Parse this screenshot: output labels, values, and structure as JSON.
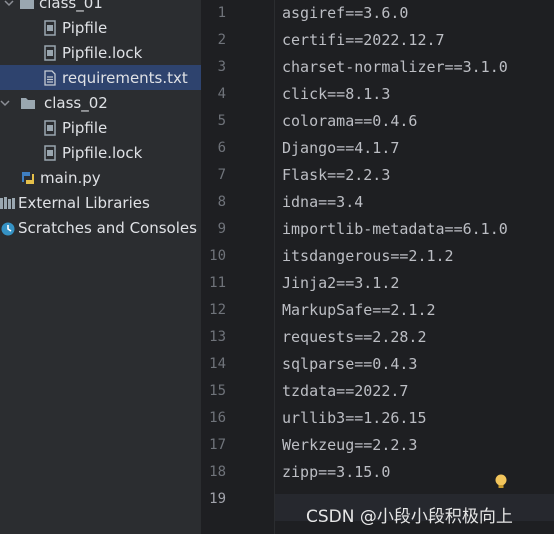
{
  "tree": {
    "class_01": "class_01",
    "pipfile_1": "Pipfile",
    "pipfile_lock_1": "Pipfile.lock",
    "requirements": "requirements.txt",
    "class_02": "class_02",
    "pipfile_2": "Pipfile",
    "pipfile_lock_2": "Pipfile.lock",
    "main": "main.py",
    "external_libraries": "External Libraries",
    "scratches": "Scratches and Consoles"
  },
  "editor": {
    "line_numbers": [
      "1",
      "2",
      "3",
      "4",
      "5",
      "6",
      "7",
      "8",
      "9",
      "10",
      "11",
      "12",
      "13",
      "14",
      "15",
      "16",
      "17",
      "18",
      "19"
    ],
    "lines": [
      "asgiref==3.6.0",
      "certifi==2022.12.7",
      "charset-normalizer==3.1.0",
      "click==8.1.3",
      "colorama==0.4.6",
      "Django==4.1.7",
      "Flask==2.2.3",
      "idna==3.4",
      "importlib-metadata==6.1.0",
      "itsdangerous==2.1.2",
      "Jinja2==3.1.2",
      "MarkupSafe==2.1.2",
      "requests==2.28.2",
      "sqlparse==0.4.3",
      "tzdata==2022.7",
      "urllib3==1.26.15",
      "Werkzeug==2.2.3",
      "zipp==3.15.0",
      ""
    ]
  },
  "watermark": "CSDN @小段小段积极向上",
  "icons": {
    "folder": "folder-icon",
    "pipfile": "pipfile-icon",
    "text_file": "text-file-icon",
    "python_file": "python-file-icon",
    "libraries": "libraries-icon",
    "scratches": "scratches-icon",
    "bulb": "lightbulb-icon"
  }
}
